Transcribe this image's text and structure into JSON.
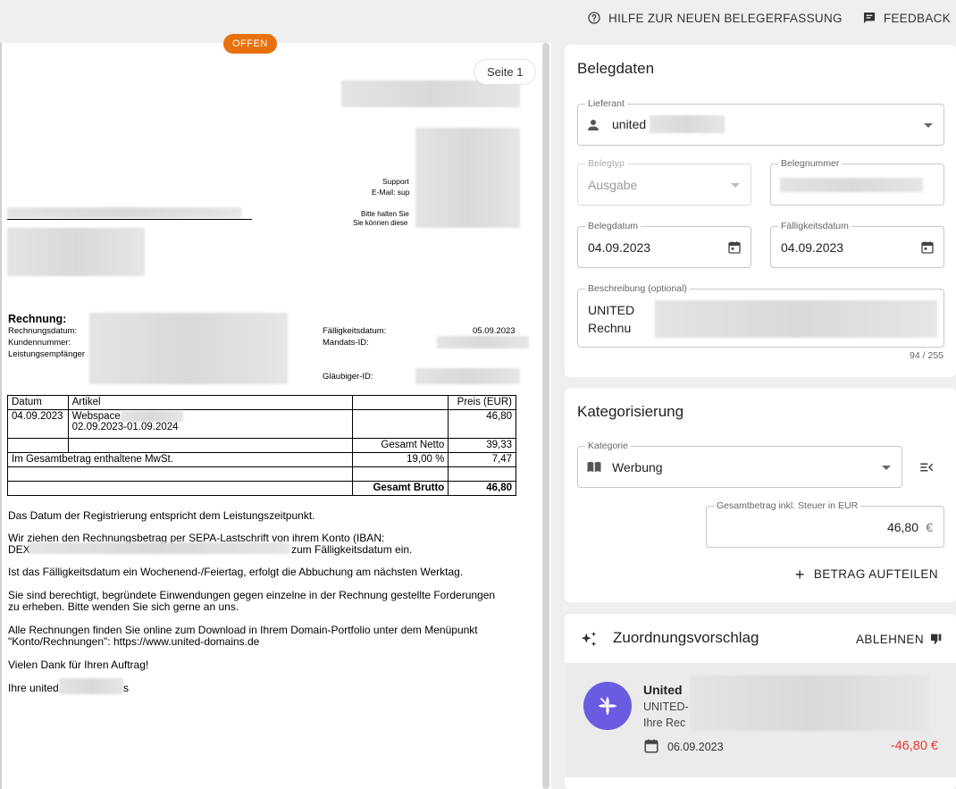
{
  "topbar": {
    "help_label": "HILFE ZUR NEUEN BELEGERFASSUNG",
    "feedback_label": "FEEDBACK"
  },
  "viewer": {
    "status": "OFFEN",
    "page_label": "Seite 1"
  },
  "document": {
    "support_label": "Support",
    "email_label": "E-Mail: sup",
    "note_line1": "Bitte halten Sie",
    "note_line2": "Sie können diese",
    "invoice_heading": "Rechnung:",
    "invoice_date_label": "Rechnungsdatum:",
    "customer_no_label": "Kundennummer:",
    "recipient_label": "Leistungsempfänger",
    "due_date_label": "Fälligkeitsdatum:",
    "due_date_value": "05.09.2023",
    "mandate_label": "Mandats-ID:",
    "creditor_label": "Gläubiger-ID:",
    "table": {
      "col_date": "Datum",
      "col_article": "Artikel",
      "col_price": "Preis (EUR)",
      "row_date": "04.09.2023",
      "row_article": "Webspace",
      "row_period": "02.09.2023-01.09.2024",
      "row_price": "46,80",
      "net_label": "Gesamt Netto",
      "net_value": "39,33",
      "vat_label": "Im Gesamtbetrag enthaltene MwSt.",
      "vat_rate": "19,00 %",
      "vat_value": "7,47",
      "gross_label": "Gesamt Brutto",
      "gross_value": "46,80"
    },
    "p1": "Das Datum der Registrierung entspricht dem Leistungszeitpunkt.",
    "p2a": "Wir ziehen den Rechnungsbetrag per SEPA-Lastschrift von ihrem Konto (IBAN:",
    "p2b_start": "DEX",
    "p2b_end": "zum Fälligkeitsdatum ein.",
    "p3": "Ist das Fälligkeitsdatum ein Wochenend-/Feiertag, erfolgt die Abbuchung am nächsten Werktag.",
    "p4a": "Sie sind berechtigt, begründete Einwendungen gegen einzelne in der Rechnung gestellte Forderungen",
    "p4b": "zu erheben. Bitte wenden Sie sich gerne an uns.",
    "p5a": "Alle Rechnungen finden Sie online zum Download in Ihrem Domain-Portfolio unter dem Menüpunkt",
    "p5b": "\"Konto/Rechnungen\": https://www.united-domains.de",
    "p6": "Vielen Dank für Ihren Auftrag!",
    "p7_start": "Ihre united",
    "p7_end": "s"
  },
  "belegdaten": {
    "title": "Belegdaten",
    "lieferant_label": "Lieferant",
    "lieferant_value": "united",
    "belegtyp_label": "Belegtyp",
    "belegtyp_value": "Ausgabe",
    "belegnummer_label": "Belegnummer",
    "belegdatum_label": "Belegdatum",
    "belegdatum_value": "04.09.2023",
    "faellig_label": "Fälligkeitsdatum",
    "faellig_value": "04.09.2023",
    "beschreibung_label": "Beschreibung (optional)",
    "beschreibung_line1": "UNITED",
    "beschreibung_line2": "Rechnu",
    "counter": "94 / 255"
  },
  "kategorisierung": {
    "title": "Kategorisierung",
    "kategorie_label": "Kategorie",
    "kategorie_value": "Werbung",
    "betrag_label": "Gesamtbetrag inkl. Steuer in EUR",
    "betrag_value": "46,80",
    "currency": "€",
    "split_label": "BETRAG AUFTEILEN"
  },
  "vorschlag": {
    "title": "Zuordnungsvorschlag",
    "reject_label": "ABLEHNEN",
    "name": "United",
    "line2": "UNITED-",
    "line3": "Ihre Rec",
    "date": "06.09.2023",
    "amount": "-46,80 €",
    "amount_color": "#e53935",
    "avatar_color": "#6a5ce0"
  }
}
